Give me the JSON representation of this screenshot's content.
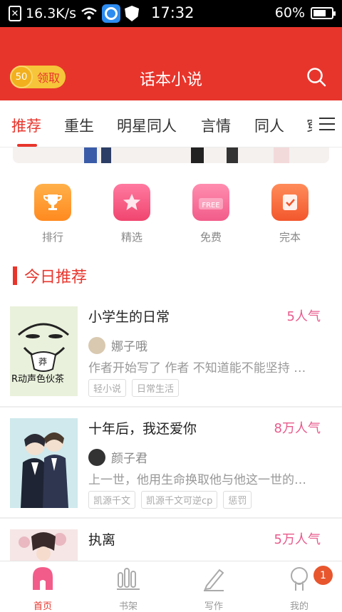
{
  "status_bar": {
    "speed": "16.3K/s",
    "time": "17:32",
    "battery": "60%"
  },
  "header": {
    "title": "话本小说",
    "coin_value": "50",
    "coin_label": "领取"
  },
  "tabs": [
    "推荐",
    "重生",
    "明星同人",
    "言情",
    "同人",
    "穿"
  ],
  "quick_links": [
    {
      "label": "排行",
      "icon": "trophy-icon"
    },
    {
      "label": "精选",
      "icon": "star-icon"
    },
    {
      "label": "免费",
      "icon": "free-icon"
    },
    {
      "label": "完本",
      "icon": "check-icon"
    }
  ],
  "section": {
    "title": "今日推荐"
  },
  "books": [
    {
      "title": "小学生的日常",
      "popularity": "5人气",
      "author": "娜子哦",
      "desc": "作者开始写了 作者 不知道能不能坚持 …",
      "tags": [
        "轻小说",
        "日常生活"
      ]
    },
    {
      "title": "十年后，我还爱你",
      "popularity": "8万人气",
      "author": "颜子君",
      "desc": "上一世，他用生命换取他与他这一世的…",
      "tags": [
        "凯源千文",
        "凯源千文可逆cp",
        "惩罚"
      ]
    },
    {
      "title": "执离",
      "popularity": "5万人气"
    }
  ],
  "bottom_nav": [
    {
      "label": "首页",
      "icon": "home-icon"
    },
    {
      "label": "书架",
      "icon": "bookshelf-icon"
    },
    {
      "label": "写作",
      "icon": "pen-icon"
    },
    {
      "label": "我的",
      "icon": "profile-icon"
    }
  ],
  "badge": "1",
  "colors": {
    "brand": "#e8352c",
    "popularity": "#e85a8c"
  }
}
